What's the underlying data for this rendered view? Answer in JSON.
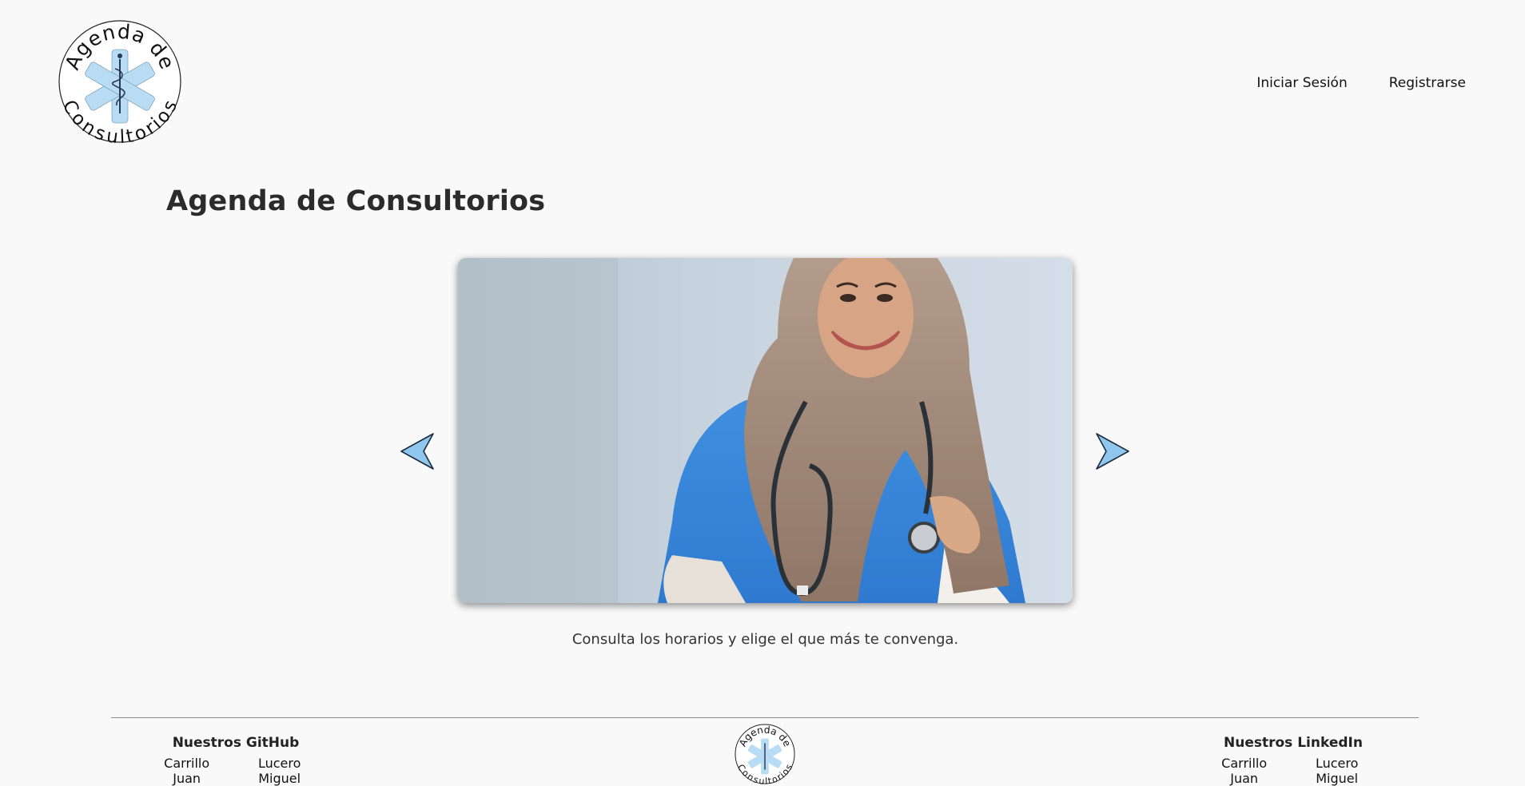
{
  "header": {
    "logo": {
      "top_text": "Agenda de",
      "bottom_text": "Consultorios"
    },
    "nav": {
      "login": "Iniciar Sesión",
      "register": "Registrarse"
    }
  },
  "main": {
    "title": "Agenda de Consultorios",
    "carousel": {
      "caption": "Consulta los horarios y elige el que más te convenga.",
      "prev_icon": "arrow-left-icon",
      "next_icon": "arrow-right-icon"
    }
  },
  "footer": {
    "github": {
      "heading": "Nuestros GitHub",
      "links": [
        "Carrillo Juan",
        "Lucero Miguel"
      ]
    },
    "linkedin": {
      "heading": "Nuestros LinkedIn",
      "links": [
        "Carrillo Juan",
        "Lucero Miguel"
      ]
    },
    "logo": {
      "top_text": "Agenda de",
      "bottom_text": "Consultorios"
    }
  },
  "colors": {
    "background": "#f9f9f9",
    "accent": "#b9dcf5",
    "text": "#222222"
  }
}
